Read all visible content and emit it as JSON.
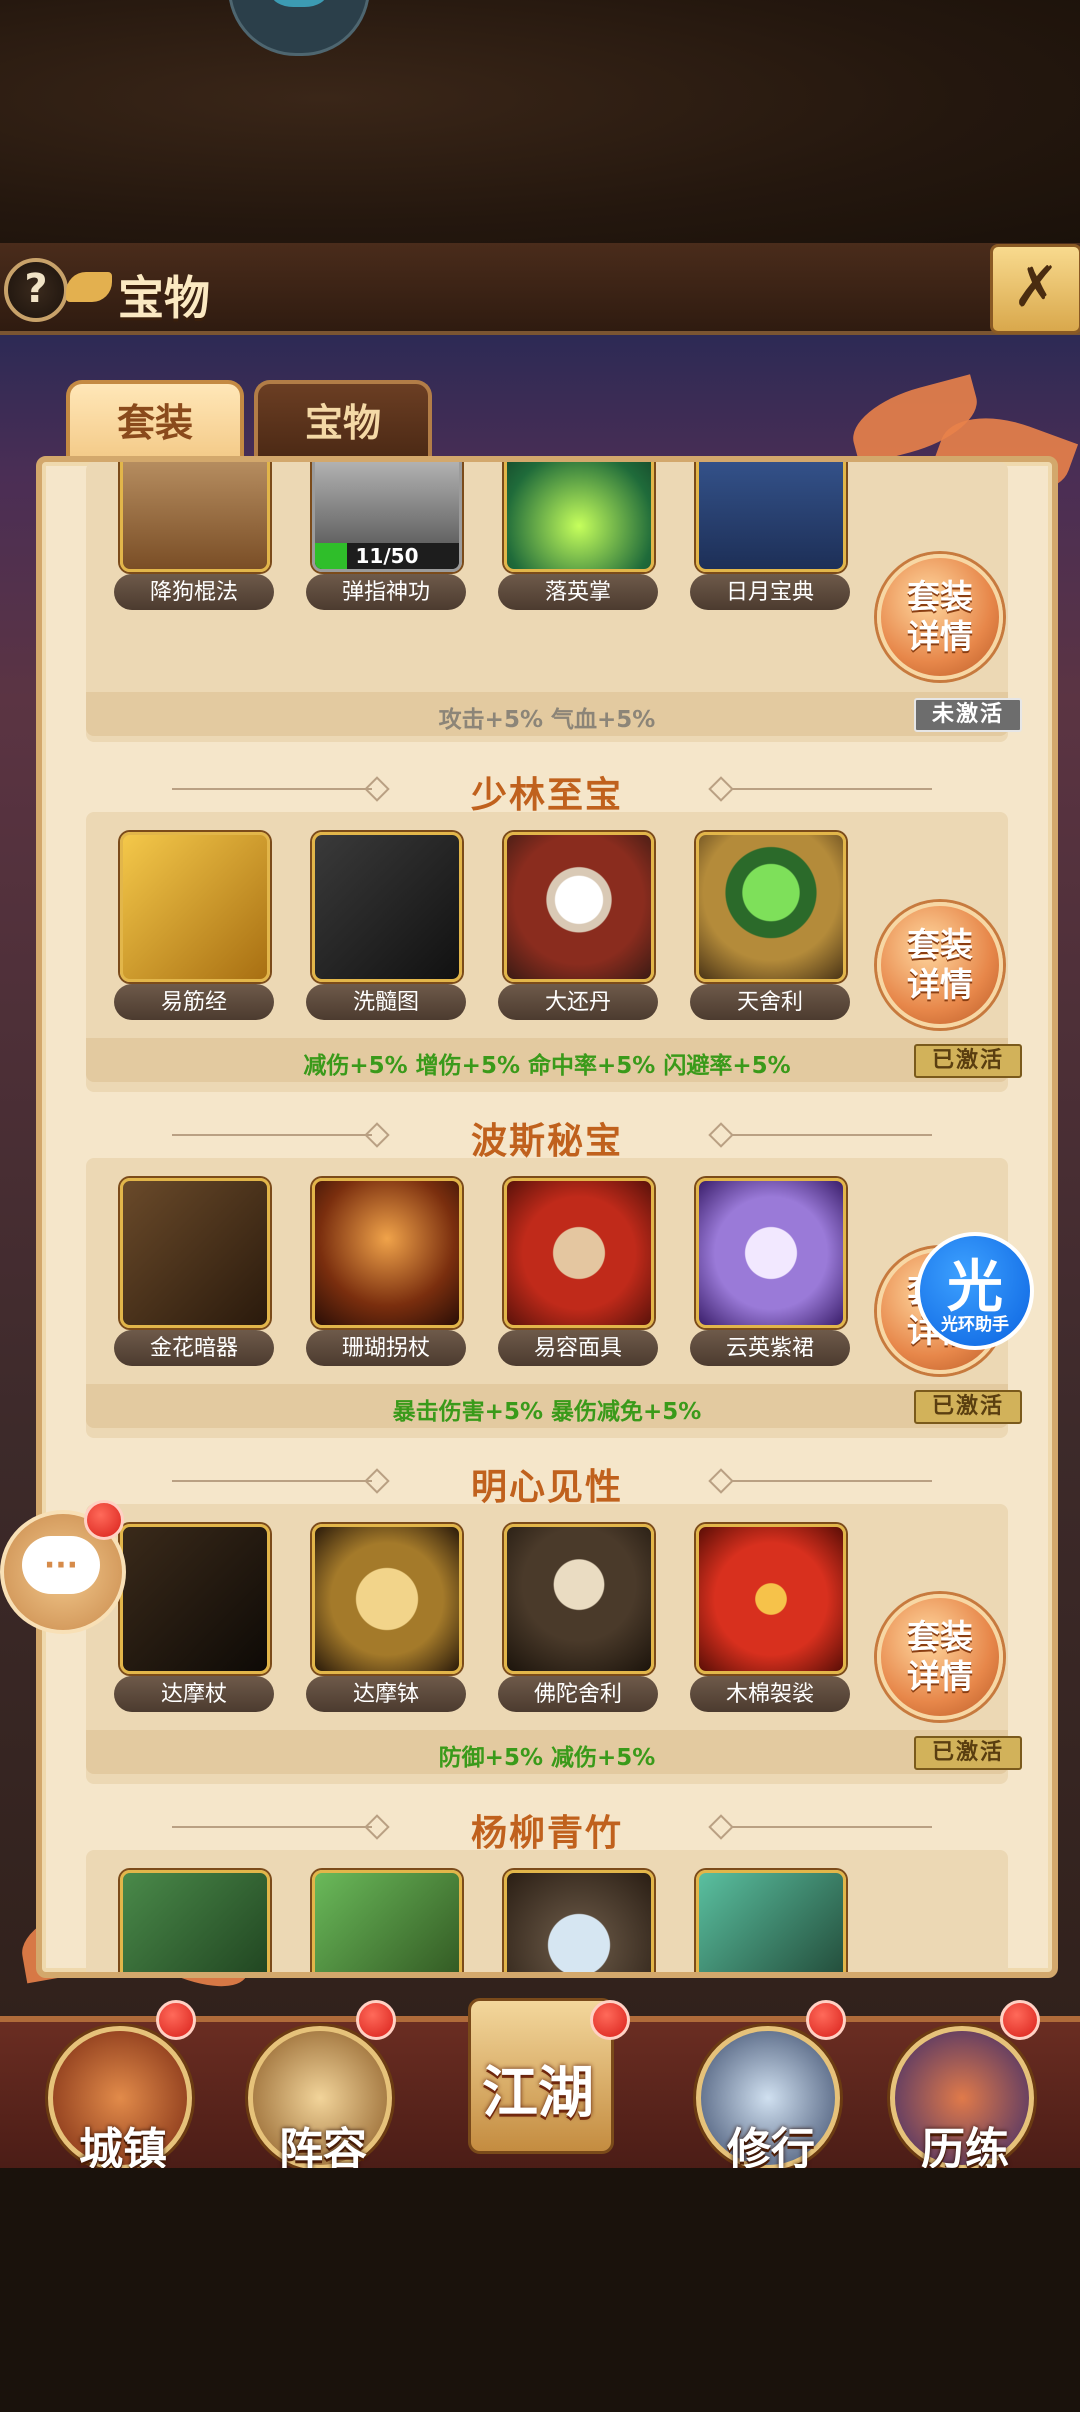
{
  "header": {
    "title": "宝物",
    "help_icon": "?",
    "close_icon": "sword-close-icon"
  },
  "tabs": [
    {
      "label": "套装",
      "active": true
    },
    {
      "label": "宝物",
      "active": false
    }
  ],
  "detail_button_label": "套装\n详情",
  "sets": [
    {
      "title": "",
      "items": [
        {
          "name": "降狗棍法",
          "icon": "book-icon"
        },
        {
          "name": "弹指神功",
          "icon": "hand-icon",
          "progress_text": "11/50",
          "progress": 0.22
        },
        {
          "name": "落英掌",
          "icon": "palm-icon"
        },
        {
          "name": "日月宝典",
          "icon": "blue-book-icon"
        }
      ],
      "bonus": "攻击+5%  气血+5%",
      "status": "未激活",
      "active": false
    },
    {
      "title": "少林至宝",
      "items": [
        {
          "name": "易筋经",
          "icon": "yellow-book-icon"
        },
        {
          "name": "洗髓图",
          "icon": "scroll-icon"
        },
        {
          "name": "大还丹",
          "icon": "pearl-icon"
        },
        {
          "name": "天舍利",
          "icon": "green-orb-icon"
        }
      ],
      "bonus": "减伤+5%  增伤+5%  命中率+5%  闪避率+5%",
      "status": "已激活",
      "active": true
    },
    {
      "title": "波斯秘宝",
      "items": [
        {
          "name": "金花暗器",
          "icon": "dart-icon"
        },
        {
          "name": "珊瑚拐杖",
          "icon": "coral-staff-icon"
        },
        {
          "name": "易容面具",
          "icon": "mask-icon"
        },
        {
          "name": "云英紫裙",
          "icon": "dress-icon"
        }
      ],
      "bonus": "暴击伤害+5%  暴伤减免+5%",
      "status": "已激活",
      "active": true
    },
    {
      "title": "明心见性",
      "items": [
        {
          "name": "达摩杖",
          "icon": "staff-icon"
        },
        {
          "name": "达摩钵",
          "icon": "bowl-icon"
        },
        {
          "name": "佛陀舍利",
          "icon": "relic-icon"
        },
        {
          "name": "木棉袈裟",
          "icon": "kasaya-icon"
        }
      ],
      "bonus": "防御+5%  减伤+5%",
      "status": "已激活",
      "active": true
    },
    {
      "title": "杨柳青竹",
      "items": [
        {
          "name": "",
          "icon": "jade-sword-icon"
        },
        {
          "name": "",
          "icon": "bamboo-flute-icon"
        },
        {
          "name": "",
          "icon": "jade-pendant-icon"
        },
        {
          "name": "",
          "icon": "jade-blade-icon"
        }
      ]
    }
  ],
  "floating": {
    "helper_glyph": "光",
    "helper_label": "光环助手",
    "chat_dots": "···"
  },
  "nav": [
    {
      "label": "城镇",
      "icon": "town-icon"
    },
    {
      "label": "阵容",
      "icon": "lineup-icon"
    },
    {
      "label": "江湖",
      "icon": "jianghu-scroll-icon"
    },
    {
      "label": "修行",
      "icon": "cultivate-icon"
    },
    {
      "label": "历练",
      "icon": "trial-icon"
    }
  ],
  "colors": {
    "accent": "#c0611d",
    "active_bonus": "#3a9a1a",
    "inactive_bonus": "#8c8578",
    "panel": "#f5e6ca"
  }
}
